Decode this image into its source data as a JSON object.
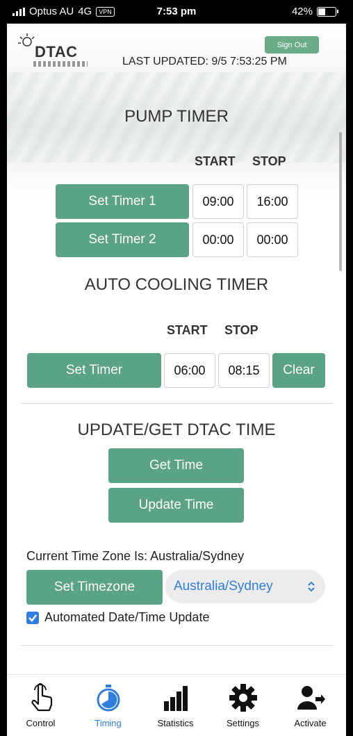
{
  "status_bar": {
    "carrier": "Optus AU",
    "network": "4G",
    "vpn": "VPN",
    "time": "7:53 pm",
    "battery": "42%"
  },
  "header": {
    "logo_text": "DTAC",
    "sign_out": "Sign Out",
    "last_updated": "LAST UPDATED: 9/5 7:53:25 PM"
  },
  "pump_timer": {
    "title": "PUMP TIMER",
    "start_label": "START",
    "stop_label": "STOP",
    "timers": [
      {
        "button": "Set Timer 1",
        "start": "09:00",
        "stop": "16:00"
      },
      {
        "button": "Set Timer 2",
        "start": "00:00",
        "stop": "00:00"
      }
    ]
  },
  "auto_cooling": {
    "title": "AUTO COOLING TIMER",
    "start_label": "START",
    "stop_label": "STOP",
    "button": "Set Timer",
    "start": "06:00",
    "stop": "08:15",
    "clear": "Clear"
  },
  "dtac_time": {
    "title": "UPDATE/GET DTAC TIME",
    "get_time": "Get Time",
    "update_time": "Update Time"
  },
  "timezone": {
    "current": "Current Time Zone Is: Australia/Sydney",
    "set_button": "Set Timezone",
    "selected": "Australia/Sydney",
    "auto_update_label": "Automated Date/Time Update",
    "auto_update_checked": true
  },
  "tabs": [
    {
      "label": "Control",
      "icon": "hand-pointer-icon"
    },
    {
      "label": "Timing",
      "icon": "stopwatch-icon",
      "active": true
    },
    {
      "label": "Statistics",
      "icon": "bar-chart-icon"
    },
    {
      "label": "Settings",
      "icon": "gear-icon"
    },
    {
      "label": "Activate",
      "icon": "user-arrow-icon"
    }
  ],
  "colors": {
    "accent_green": "#5aa385",
    "accent_blue": "#2f7de1"
  }
}
